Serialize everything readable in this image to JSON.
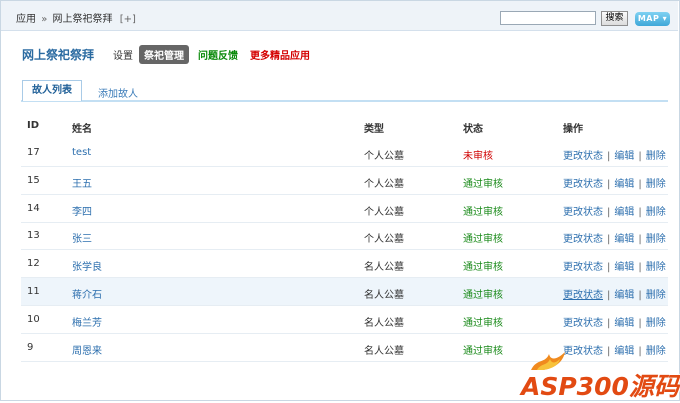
{
  "breadcrumb": {
    "root": "应用",
    "sep": "»",
    "current": "网上祭祀祭拜",
    "add": "[+]"
  },
  "search": {
    "value": "",
    "button": "搜索"
  },
  "map_button": "MAP",
  "app": {
    "title": "网上祭祀祭拜",
    "nav": {
      "settings": "设置",
      "manage": "祭祀管理",
      "feedback": "问题反馈",
      "more": "更多精品应用"
    }
  },
  "tabs": {
    "list": "故人列表",
    "add": "添加故人"
  },
  "table": {
    "headers": {
      "id": "ID",
      "name": "姓名",
      "type": "类型",
      "status": "状态",
      "ops": "操作"
    },
    "op_labels": {
      "change": "更改状态",
      "edit": "编辑",
      "delete": "删除",
      "sep": "|"
    },
    "rows": [
      {
        "id": "17",
        "name": "test",
        "type": "个人公墓",
        "status": "未审核"
      },
      {
        "id": "15",
        "name": "王五",
        "type": "个人公墓",
        "status": "通过审核"
      },
      {
        "id": "14",
        "name": "李四",
        "type": "个人公墓",
        "status": "通过审核"
      },
      {
        "id": "13",
        "name": "张三",
        "type": "个人公墓",
        "status": "通过审核"
      },
      {
        "id": "12",
        "name": "张学良",
        "type": "名人公墓",
        "status": "通过审核"
      },
      {
        "id": "11",
        "name": "蒋介石",
        "type": "名人公墓",
        "status": "通过审核"
      },
      {
        "id": "10",
        "name": "梅兰芳",
        "type": "名人公墓",
        "status": "通过审核"
      },
      {
        "id": "9",
        "name": "周恩来",
        "type": "名人公墓",
        "status": "通过审核"
      }
    ]
  },
  "watermark": "ASP300源码",
  "colors": {
    "accent": "#2b6ba1",
    "pending": "#d00000",
    "pass": "#1a8a1a",
    "feedback": "#0a8a0a",
    "more": "#d40000"
  }
}
